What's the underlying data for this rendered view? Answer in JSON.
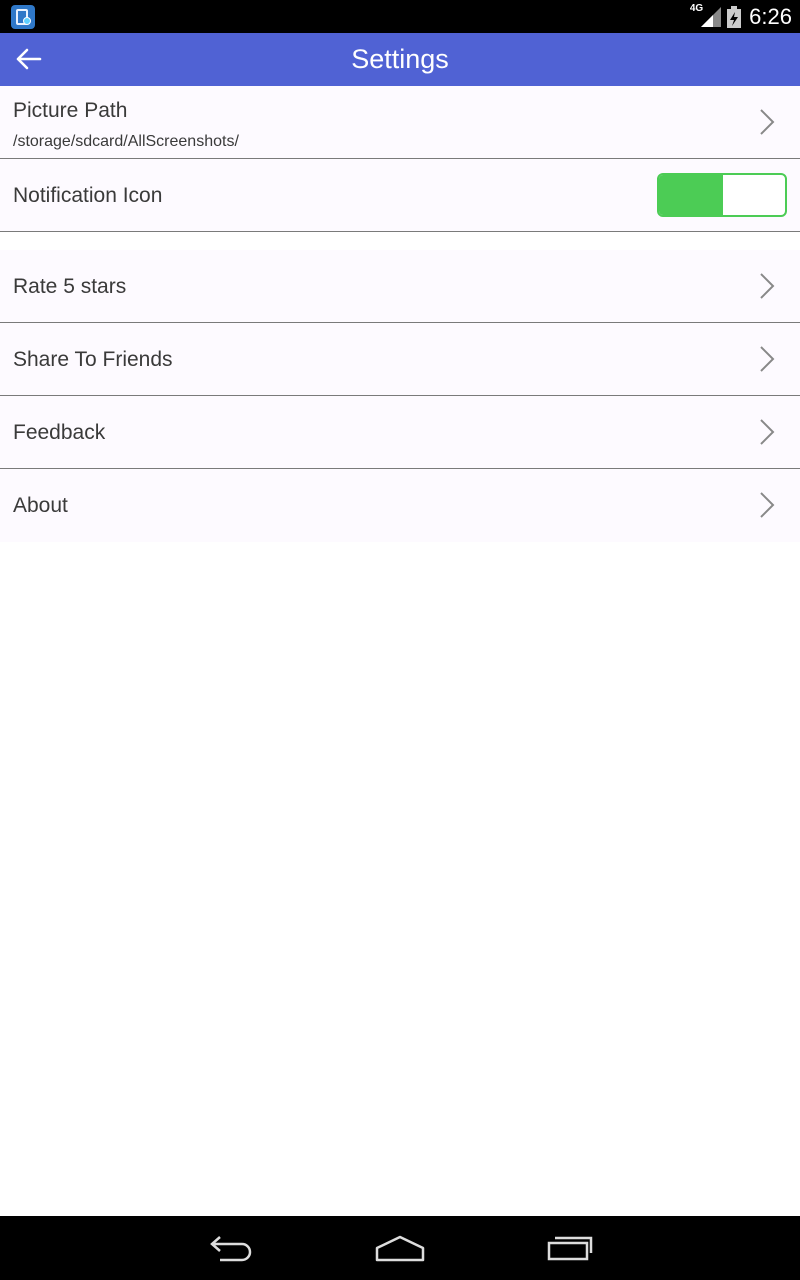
{
  "status_bar": {
    "time": "6:26",
    "network_label": "4G",
    "icons": [
      "app-notification-icon",
      "signal-icon",
      "battery-icon"
    ]
  },
  "toolbar": {
    "title": "Settings",
    "back_icon": "back-arrow-icon",
    "color": "#5062d4"
  },
  "settings": {
    "picture_path": {
      "label": "Picture Path",
      "value": "/storage/sdcard/AllScreenshots/"
    },
    "notification_icon": {
      "label": "Notification Icon",
      "enabled": true,
      "toggle_color": "#4ccc55"
    },
    "rate": {
      "label": "Rate 5 stars"
    },
    "share": {
      "label": "Share To Friends"
    },
    "feedback": {
      "label": "Feedback"
    },
    "about": {
      "label": "About"
    }
  },
  "nav_bar": {
    "icons": [
      "back-icon",
      "home-icon",
      "recent-apps-icon"
    ]
  }
}
